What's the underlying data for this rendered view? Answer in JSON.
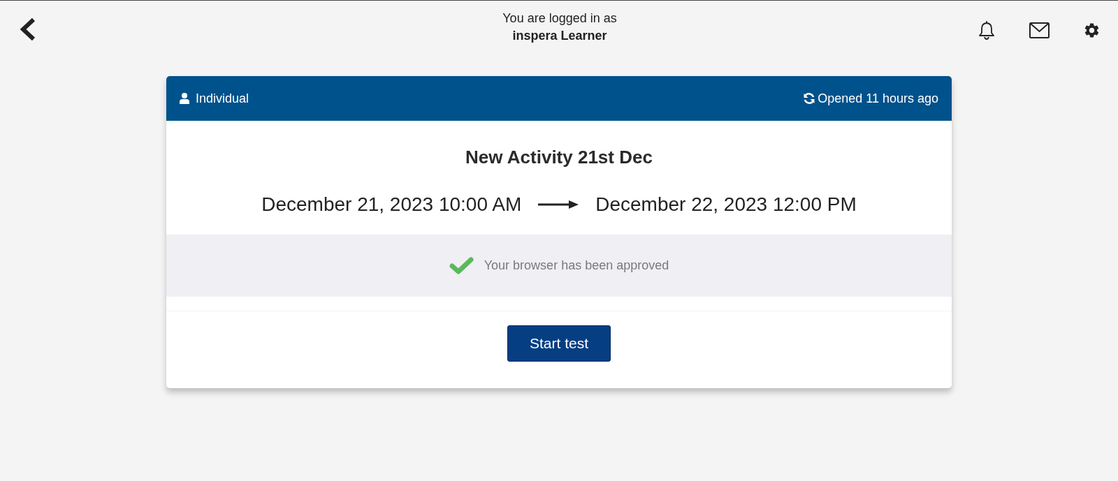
{
  "top_bar": {
    "login_label": "You are logged in as",
    "user_name": "inspera Learner"
  },
  "card": {
    "type_label": "Individual",
    "opened": "Opened 11 hours ago",
    "title": "New Activity 21st Dec",
    "start": "December 21, 2023 10:00 AM",
    "end": "December 22, 2023 12:00 PM",
    "browser_check": {
      "approved": true,
      "message": "Your browser has been approved"
    },
    "button": "Start test"
  }
}
